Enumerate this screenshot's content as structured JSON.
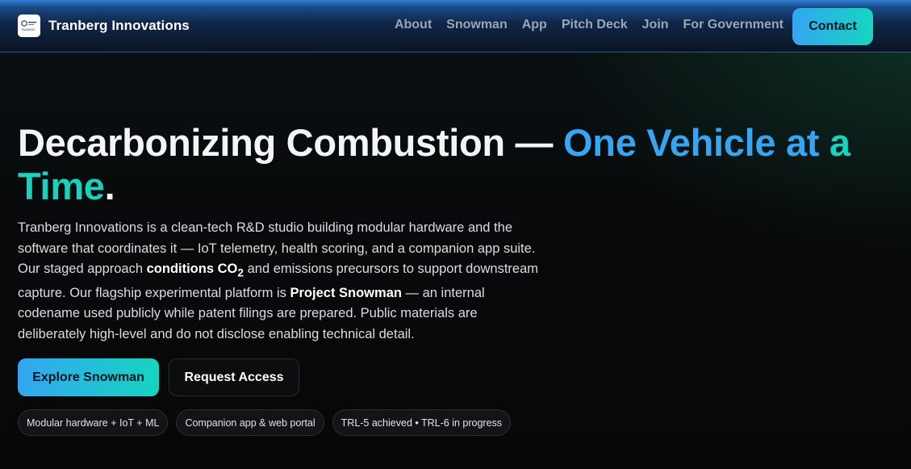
{
  "header": {
    "brand_name": "Tranberg Innovations",
    "logo_text": "TRANBERG",
    "nav": [
      {
        "label": "About"
      },
      {
        "label": "Snowman"
      },
      {
        "label": "App"
      },
      {
        "label": "Pitch Deck"
      },
      {
        "label": "Join"
      },
      {
        "label": "For Government"
      }
    ],
    "contact_label": "Contact"
  },
  "hero": {
    "headline_main": "Decarbonizing Combustion — ",
    "headline_accent_1": "One Vehicle at",
    "headline_accent_2": "a Time",
    "headline_end": ".",
    "desc_1": "Tranberg Innovations is a clean-tech R&D studio building modular hardware and the software that coordinates it — IoT telemetry, health scoring, and a companion app suite. Our staged approach ",
    "desc_bold_1": "conditions CO",
    "desc_sub": "2",
    "desc_2": " and emissions precursors to support downstream capture. Our flagship experimental platform is ",
    "desc_bold_2": "Project Snowman",
    "desc_3": " — an internal codename used publicly while patent filings are prepared. Public materials are deliberately high-level and do not disclose enabling technical detail.",
    "primary_button": "Explore Snowman",
    "secondary_button": "Request Access",
    "pills": [
      {
        "label": "Modular hardware + IoT + ML"
      },
      {
        "label": "Companion app & web portal"
      },
      {
        "label": "TRL-5 achieved • TRL-6 in progress"
      }
    ]
  },
  "colors": {
    "accent_blue": "#35a5f4",
    "accent_teal": "#19d2bd",
    "header_top": "#2f7fd6",
    "background": "#070808"
  }
}
